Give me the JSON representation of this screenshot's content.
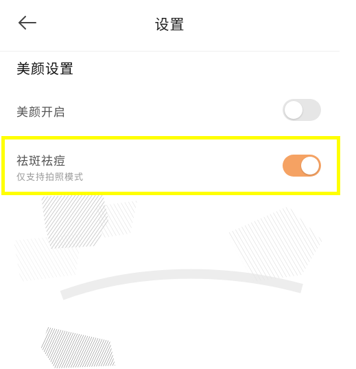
{
  "header": {
    "title": "设置",
    "back_icon": "arrow-left-icon"
  },
  "section": {
    "title": "美颜设置"
  },
  "settings": [
    {
      "label": "美颜开启",
      "subtitle": "",
      "enabled": false
    },
    {
      "label": "祛斑祛痘",
      "subtitle": "仅支持拍照模式",
      "enabled": true
    }
  ],
  "colors": {
    "toggle_on": "#f5a263",
    "toggle_off": "#e6e6e6",
    "highlight": "#ffff00"
  }
}
